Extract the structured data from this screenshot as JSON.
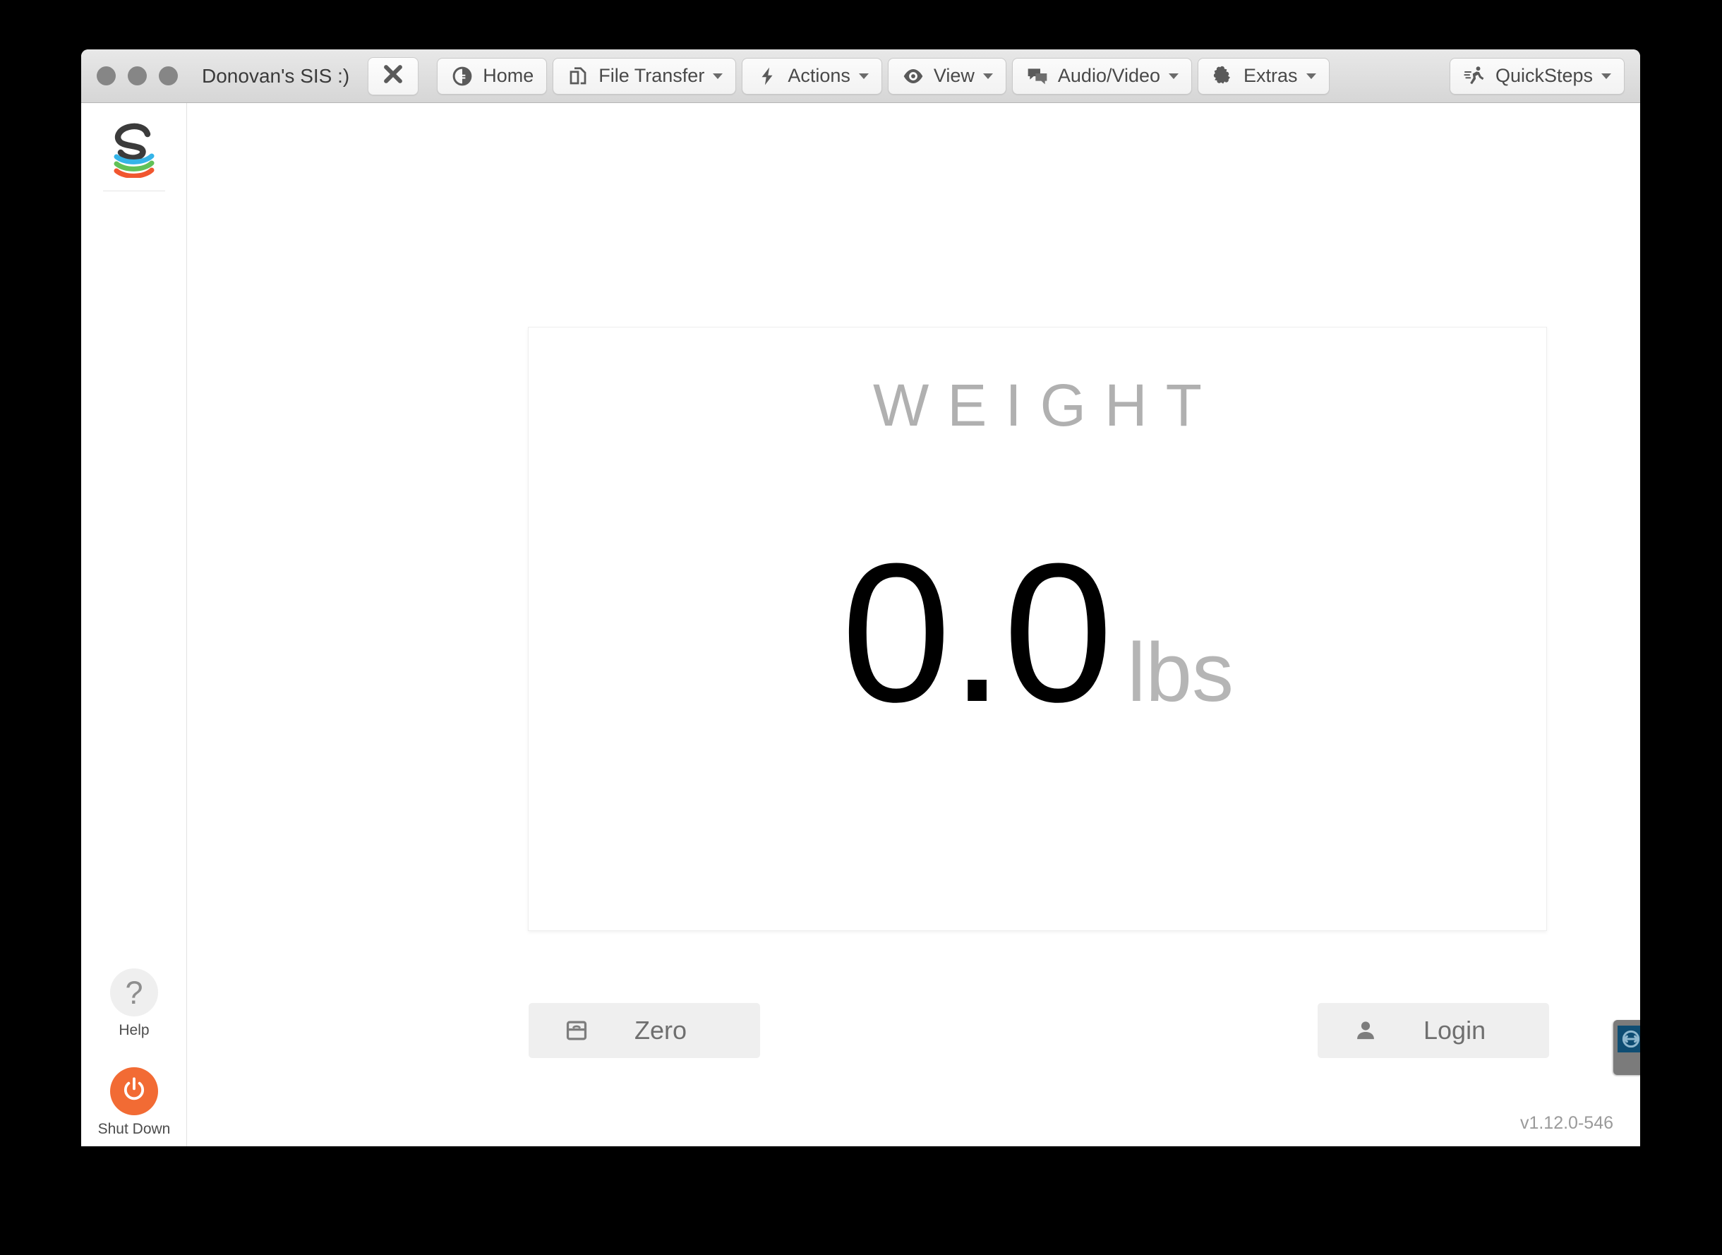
{
  "window": {
    "title": "Donovan's SIS :)",
    "close_icon": "close-x-icon",
    "traffic_lights": [
      "close-dot",
      "minimize-dot",
      "zoom-dot"
    ]
  },
  "toolbar": {
    "items": [
      {
        "label": "Home",
        "icon": "home-pie-icon",
        "has_caret": false
      },
      {
        "label": "File Transfer",
        "icon": "copy-documents-icon",
        "has_caret": true
      },
      {
        "label": "Actions",
        "icon": "lightning-bolt-icon",
        "has_caret": true
      },
      {
        "label": "View",
        "icon": "eye-icon",
        "has_caret": true
      },
      {
        "label": "Audio/Video",
        "icon": "speech-bubbles-icon",
        "has_caret": true
      },
      {
        "label": "Extras",
        "icon": "puzzle-piece-icon",
        "has_caret": true
      }
    ],
    "quicksteps": {
      "label": "QuickSteps",
      "icon": "running-person-icon",
      "has_caret": true
    }
  },
  "sidebar": {
    "logo": "sis-s-logo",
    "items": [
      {
        "label": "Help",
        "icon": "question-mark-icon",
        "circle_color": "#efefef"
      },
      {
        "label": "Shut Down",
        "icon": "power-icon",
        "circle_color": "#f26b34"
      }
    ]
  },
  "main": {
    "panel_title": "WEIGHT",
    "weight_value": "0.0",
    "weight_unit": "lbs",
    "buttons": [
      {
        "name": "zero",
        "label": "Zero",
        "icon": "scale-icon"
      },
      {
        "name": "login",
        "label": "Login",
        "icon": "person-icon"
      }
    ],
    "version": "v1.12.0-546"
  },
  "overlay": {
    "remote_badge_icon": "teamviewer-arrows-icon"
  }
}
